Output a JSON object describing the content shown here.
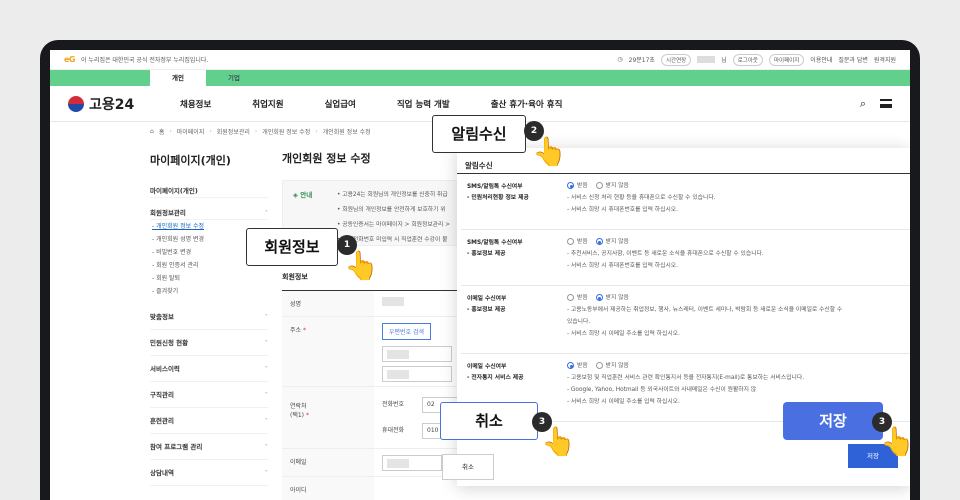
{
  "topbar": {
    "logo": "eG",
    "gov_text": "이 누리집은 대한민국 공식 전자정부 누리집입니다.",
    "timer": "29분17초",
    "extend": "시간연장",
    "user_suffix": "님",
    "logout": "로그아웃",
    "mypage": "마이페이지",
    "guide": "이용안내",
    "qna": "질문과 답변",
    "remote": "원격지원"
  },
  "tabs": [
    "개인",
    "기업"
  ],
  "header": {
    "brand": "고용24",
    "menu": [
      "채용정보",
      "취업지원",
      "실업급여",
      "직업 능력 개발",
      "출산 휴가·육아 휴직"
    ]
  },
  "breadcrumb": [
    "홈",
    "마이페이지",
    "회원정보관리",
    "개인회원 정보 수정",
    "개인회원 정보 수정"
  ],
  "sidebar": {
    "title": "마이페이지(개인)",
    "top_item": "마이페이지(개인)",
    "group": "회원정보관리",
    "subs": [
      "개인회원 정보 수정",
      "개인회원 성명 변경",
      "비밀번호 변경",
      "회원 인증서 관리",
      "회원 탈퇴",
      "즐겨찾기"
    ],
    "groups": [
      "맞춤정보",
      "민원신청 현황",
      "서비스이력",
      "구직관리",
      "훈련관리",
      "참여 프로그램 관리",
      "상담내역"
    ]
  },
  "main": {
    "title": "개인회원 정보 수정",
    "notice_label": "안내",
    "notice_lines": [
      "고용24는 회원님의 개인정보를 신중히 취급",
      "회원님의 개인정보를 안전하게 보호하기 위",
      "공동인증서는 마이페이지 > 회원정보관리 >",
      "휴대전화번호 미입력 시 직업훈련 수강이 불"
    ],
    "section": "회원정보",
    "rows": {
      "name": "성명",
      "address": "주소",
      "address_required": "*",
      "zip_button": "우편번호 검색",
      "contact": "연락처",
      "contact_sub": "(택1)",
      "phone": "전화번호",
      "phone_value": "02",
      "mobile": "휴대전화",
      "mobile_value": "010",
      "email": "이메일",
      "id": "아이디"
    }
  },
  "panel": {
    "title": "알림수신",
    "rows": [
      {
        "label": "SMS/알림톡 수신여부",
        "sublabel": "- 민원처리현황 정보 제공",
        "opt_yes": "받음",
        "opt_no": "받지 않음",
        "selected": "yes",
        "notes": [
          "- 서비스 신청 처리 현황 등을 휴대폰으로 수신할 수 있습니다.",
          "- 서비스 희망 시 휴대폰번호를 입력 하십시오."
        ]
      },
      {
        "label": "SMS/알림톡 수신여부",
        "sublabel": "- 홍보정보 제공",
        "opt_yes": "받음",
        "opt_no": "받지 않음",
        "selected": "no",
        "notes": [
          "- 추천서비스, 공지사항, 이벤트 등 새로운 소식을 휴대폰으로 수신할 수 있습니다.",
          "- 서비스 희망 시 휴대폰번호를 입력 하십시오."
        ]
      },
      {
        "label": "이메일 수신여부",
        "sublabel": "- 홍보정보 제공",
        "opt_yes": "받음",
        "opt_no": "받지 않음",
        "selected": "no",
        "notes": [
          "- 고용노동부에서 제공하는 취업정보, 행사, 뉴스레터, 이벤트 세미나, 박람회 등 새로운 소식을 이메일로 수신할 수",
          "  있습니다.",
          "- 서비스 희망 시 이메일 주소를 입력 하십시오."
        ]
      },
      {
        "label": "이메일 수신여부",
        "sublabel": "- 전자통지 서비스 제공",
        "opt_yes": "받음",
        "opt_no": "받지 않음",
        "selected": "yes",
        "notes": [
          "- 고용보험 및 직업훈련 서비스 관련 확인통지서 등을 전자통지(E-mail)로 통보하는 서비스입니다.",
          "- Google, Yahoo, Hotmail 등 외국사이트와 사내메일은 수신이 원활하지 않",
          "- 서비스 희망 시 이메일 주소를 입력 하십시오."
        ]
      }
    ],
    "save": "저장"
  },
  "bottom_cancel": "취소",
  "callouts": {
    "member_info": "회원정보",
    "member_info_num": "1",
    "alert": "알림수신",
    "alert_num": "2",
    "cancel": "취소",
    "cancel_num": "3",
    "save": "저장",
    "save_num": "3"
  },
  "colors": {
    "green": "#62cf8d",
    "primary": "#2f62d6",
    "callout_blue": "#4a6fe0"
  }
}
